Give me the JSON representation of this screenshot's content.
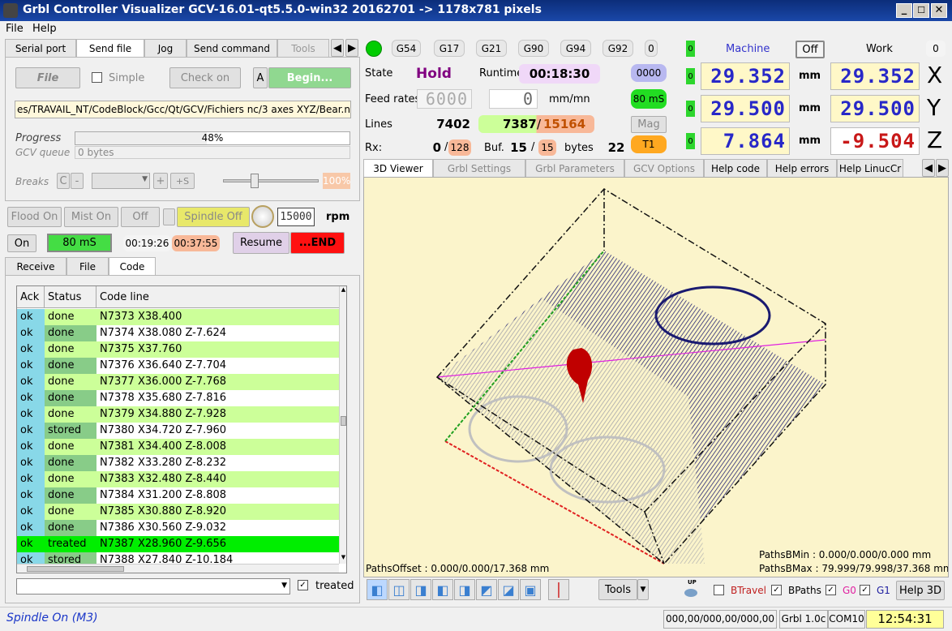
{
  "window": {
    "title": "Grbl Controller Visualizer  GCV-16.01-qt5.5.0-win32  20162701  -> 1178x781 pixels"
  },
  "menu": {
    "file": "File",
    "help": "Help"
  },
  "left_tabs": [
    "Serial port",
    "Send file",
    "Jog",
    "Send command",
    "Tools"
  ],
  "sendfile": {
    "file_btn": "File",
    "simple": "Simple",
    "checkon": "Check on",
    "a_btn": "A",
    "begin": "Begin...",
    "path": "es/TRAVAIL_NT/CodeBlock/Gcc/Qt/GCV/Fichiers nc/3 axes XYZ/Bear.nc",
    "progress_label": "Progress",
    "progress_text": "48%",
    "progress_value": 48,
    "queue_label": "GCV queue",
    "queue_value": "0 bytes",
    "breaks_label": "Breaks",
    "c_btn": "C",
    "minus_btn": "-",
    "plus_btn": "+",
    "plus_s_btn": "+S",
    "slider_pct": "100%"
  },
  "spindle": {
    "flood": "Flood On",
    "mist": "Mist On",
    "off": "Off",
    "spindle_off": "Spindle Off",
    "rpm_value": "15000",
    "rpm": "rpm",
    "on": "On",
    "ms": "80 mS",
    "time1": "00:19:26",
    "time2": "00:37:55",
    "resume": "Resume",
    "end": "...END"
  },
  "code_tabs": [
    "Receive",
    "File",
    "Code"
  ],
  "table": {
    "headers": [
      "Ack",
      "Status",
      "Code line"
    ],
    "rows": [
      {
        "ack": "ok",
        "status": "done",
        "code": "N7373 X38.400",
        "hl": false
      },
      {
        "ack": "ok",
        "status": "done",
        "code": "N7374 X38.080 Z-7.624",
        "hl": false
      },
      {
        "ack": "ok",
        "status": "done",
        "code": "N7375 X37.760",
        "hl": false
      },
      {
        "ack": "ok",
        "status": "done",
        "code": "N7376 X36.640 Z-7.704",
        "hl": false
      },
      {
        "ack": "ok",
        "status": "done",
        "code": "N7377 X36.000 Z-7.768",
        "hl": false
      },
      {
        "ack": "ok",
        "status": "done",
        "code": "N7378 X35.680 Z-7.816",
        "hl": false
      },
      {
        "ack": "ok",
        "status": "done",
        "code": "N7379 X34.880 Z-7.928",
        "hl": false
      },
      {
        "ack": "ok",
        "status": "stored",
        "code": "N7380 X34.720 Z-7.960",
        "hl": false
      },
      {
        "ack": "ok",
        "status": "done",
        "code": "N7381 X34.400 Z-8.008",
        "hl": false
      },
      {
        "ack": "ok",
        "status": "done",
        "code": "N7382 X33.280 Z-8.232",
        "hl": false
      },
      {
        "ack": "ok",
        "status": "done",
        "code": "N7383 X32.480 Z-8.440",
        "hl": false
      },
      {
        "ack": "ok",
        "status": "done",
        "code": "N7384 X31.200 Z-8.808",
        "hl": false
      },
      {
        "ack": "ok",
        "status": "done",
        "code": "N7385 X30.880 Z-8.920",
        "hl": false
      },
      {
        "ack": "ok",
        "status": "done",
        "code": "N7386 X30.560 Z-9.032",
        "hl": false
      },
      {
        "ack": "ok",
        "status": "treated",
        "code": "N7387 X28.960 Z-9.656",
        "hl": true
      },
      {
        "ack": "ok",
        "status": "stored",
        "code": "N7388 X27.840 Z-10.184",
        "hl": false
      }
    ]
  },
  "filter": {
    "treated": "treated"
  },
  "gcodes": [
    "G54",
    "G17",
    "G21",
    "G90",
    "G94",
    "G92",
    "0"
  ],
  "state": {
    "label": "State",
    "value": "Hold",
    "runtime_label": "Runtime",
    "runtime": "00:18:30",
    "code": "0000",
    "ms": "80 mS",
    "mag": "Mag",
    "tool": "T1",
    "feed_label": "Feed rates",
    "feed": "6000",
    "feed2": "0",
    "feed_unit": "mm/mn",
    "lines_label": "Lines",
    "lines_total": "7402",
    "lines_cur": "7387",
    "lines_of": "15164",
    "rx_label": "Rx:",
    "rx": "0",
    "rx_max": "128",
    "buf_label": "Buf.",
    "buf": "15",
    "buf_max": "15",
    "bytes": "bytes",
    "bytes_val": "22"
  },
  "coords": {
    "machine": "Machine",
    "off": "Off",
    "work": "Work",
    "zero": "0",
    "mm": "mm",
    "led": "0",
    "axes": [
      {
        "name": "X",
        "machine": "29.352",
        "work": "29.352"
      },
      {
        "name": "Y",
        "machine": "29.500",
        "work": "29.500"
      },
      {
        "name": "Z",
        "machine": "7.864",
        "work": "-9.504"
      }
    ]
  },
  "right_tabs": [
    "3D Viewer",
    "Grbl Settings",
    "Grbl Parameters",
    "GCV Options",
    "Help code",
    "Help errors",
    "Help LinucCr"
  ],
  "viewer": {
    "paths_offset": "PathsOffset : 0.000/0.000/17.368 mm",
    "paths_min": "PathsBMin : 0.000/0.000/0.000 mm",
    "paths_max": "PathsBMax : 79.999/79.998/37.368 mm"
  },
  "bottom": {
    "tools": "Tools",
    "up": "UP",
    "btravel": "BTravel",
    "bpaths": "BPaths",
    "g0": "G0",
    "g1": "G1",
    "help3d": "Help 3D"
  },
  "status": {
    "left": "Spindle On (M3)",
    "coords": "000,00/000,00/000,00",
    "grbl": "Grbl 1.0c",
    "com": "COM10",
    "clock": "12:54:31"
  },
  "colors": {
    "title_bar": "#0a246a",
    "lcd_bg": "#fff8c8",
    "lcd_fg": "#2828c8",
    "lcd_neg": "#c81818",
    "row_green": "#ccff99",
    "row_hl": "#00ee00",
    "status_cell": "#88cc88",
    "ack_cell": "#88d8e8",
    "viewer_bg": "#fbf4cb"
  }
}
